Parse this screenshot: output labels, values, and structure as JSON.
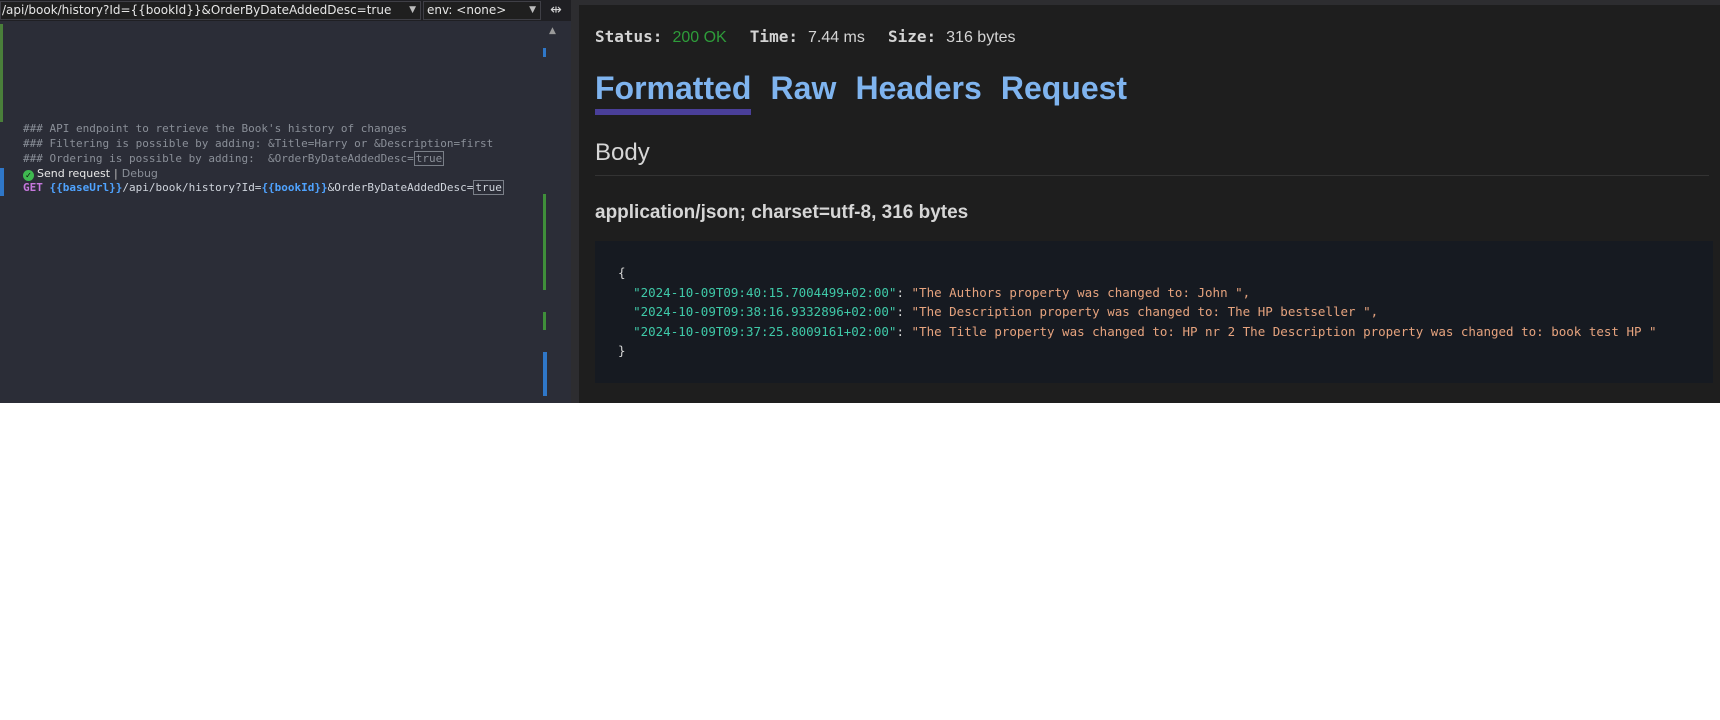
{
  "editor": {
    "url_combo_value": "/api/book/history?Id={{bookId}}&OrderByDateAddedDesc=true",
    "env_combo_value": "env: <none>",
    "comments": [
      "### API endpoint to retrieve the Book's history of changes",
      "### Filtering is possible by adding: &Title=Harry or &Description=first",
      "### Ordering is possible by adding:  &OrderByDateAddedDesc="
    ],
    "comment_boxed_value": "true",
    "codelens": {
      "send": "Send request",
      "separator": "|",
      "debug": "Debug"
    },
    "request": {
      "method": "GET",
      "base_var": "{{baseUrl}}",
      "path": "/api/book/history?Id=",
      "id_var": "{{bookId}}",
      "query": "&OrderByDateAddedDesc=",
      "query_value": "true"
    }
  },
  "response": {
    "status_label": "Status:",
    "status_value": "200 OK",
    "time_label": "Time:",
    "time_value": "7.44 ms",
    "size_label": "Size:",
    "size_value": "316 bytes",
    "tabs": [
      "Formatted",
      "Raw",
      "Headers",
      "Request"
    ],
    "body_heading": "Body",
    "content_type": "application/json; charset=utf-8, 316 bytes",
    "json": {
      "open": "{",
      "close": "}",
      "entries": [
        {
          "key": "\"2024-10-09T09:40:15.7004499+02:00\"",
          "value": "\"The Authors property was changed to: John \","
        },
        {
          "key": "\"2024-10-09T09:38:16.9332896+02:00\"",
          "value": "\"The Description property was changed to: The HP bestseller \","
        },
        {
          "key": "\"2024-10-09T09:37:25.8009161+02:00\"",
          "value": "\"The Title property was changed to: HP nr 2 The Description property was changed to: book test HP \""
        }
      ]
    }
  },
  "colors": {
    "editor_bg": "#2b2d37",
    "response_bg": "#1e1e1e",
    "tab_link": "#7fb4ef",
    "tab_underline": "#4a3f99",
    "status_ok": "#2e9c3a",
    "json_key": "#3fc9a8",
    "json_value": "#e6a37e"
  }
}
